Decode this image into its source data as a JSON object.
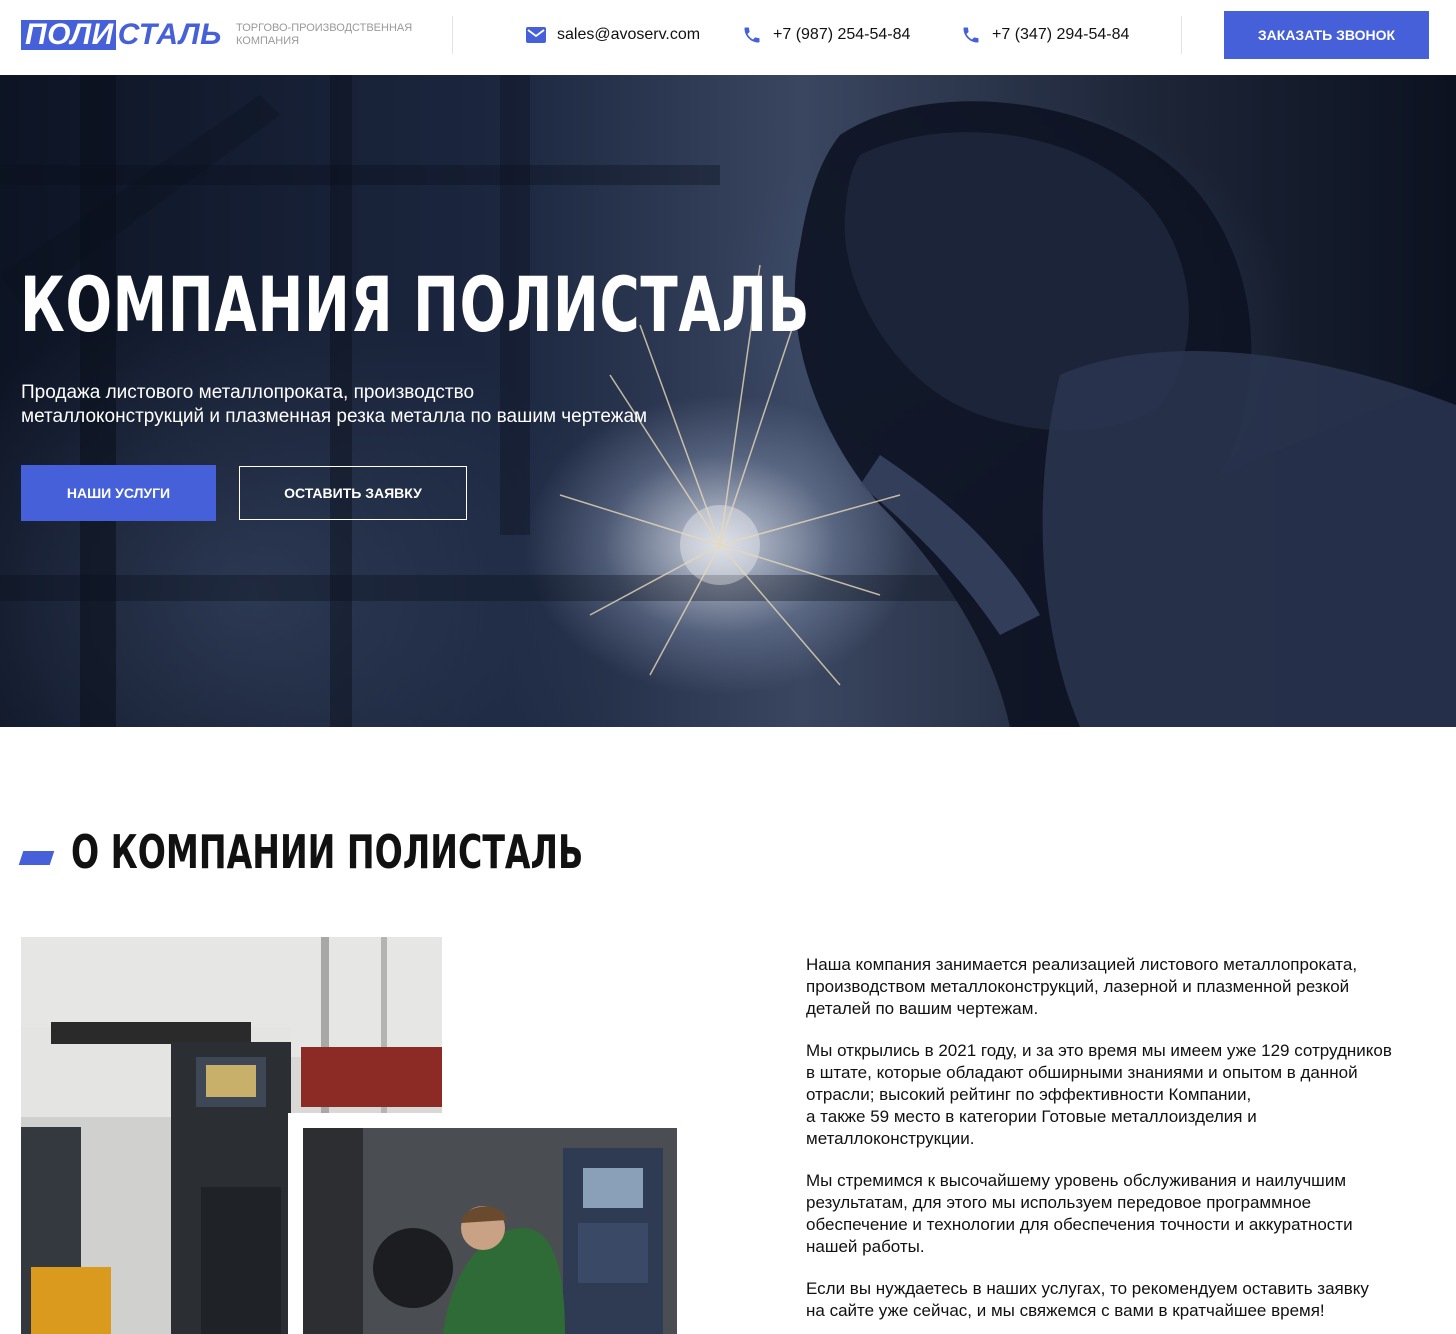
{
  "header": {
    "logo": {
      "part1": "ПОЛИ",
      "part2": "СТАЛЬ"
    },
    "tagline": "Торгово-производственная компания",
    "email": "sales@avoserv.com",
    "phone1": "+7 (987) 254-54-84",
    "phone2": "+7 (347) 294-54-84",
    "call_button": "Заказать звонок",
    "icons": {
      "email": "mail-icon",
      "phone": "phone-icon"
    },
    "accent_color": "#4560d8"
  },
  "hero": {
    "title": "КОМПАНИЯ ПОЛИСТАЛЬ",
    "subtitle_line1": "Продажа листового металлопроката, производство",
    "subtitle_line2": "металлоконструкций и плазменная резка металла по вашим чертежам",
    "btn_services": "Наши услуги",
    "btn_request": "Оставить заявку"
  },
  "about": {
    "title": "О КОМПАНИИ ПОЛИСТАЛЬ",
    "paragraphs": [
      "Наша компания занимается реализацией листового металлопроката,\nпроизводством металлоконструкций, лазерной и плазменной резкой\nдеталей по вашим чертежам.",
      "Мы открылись в 2021 году, и за это время мы имеем уже 129 сотрудников\nв штате, которые обладают обширными знаниями и опытом в данной\nотрасли; высокий рейтинг по эффективности Компании,\nа также 59 место в категории Готовые металлоизделия и\nметаллоконструкции.",
      "Мы стремимся к высочайшему уровень обслуживания и наилучшим\nрезультатам, для этого мы используем передовое программное\nобеспечение и технологии для обеспечения точности и аккуратности\nнашей работы.",
      "Если вы нуждаетесь в наших услугах, то рекомендуем оставить заявку\nна сайте уже сейчас, и мы свяжемся с вами в кратчайшее время!"
    ]
  }
}
